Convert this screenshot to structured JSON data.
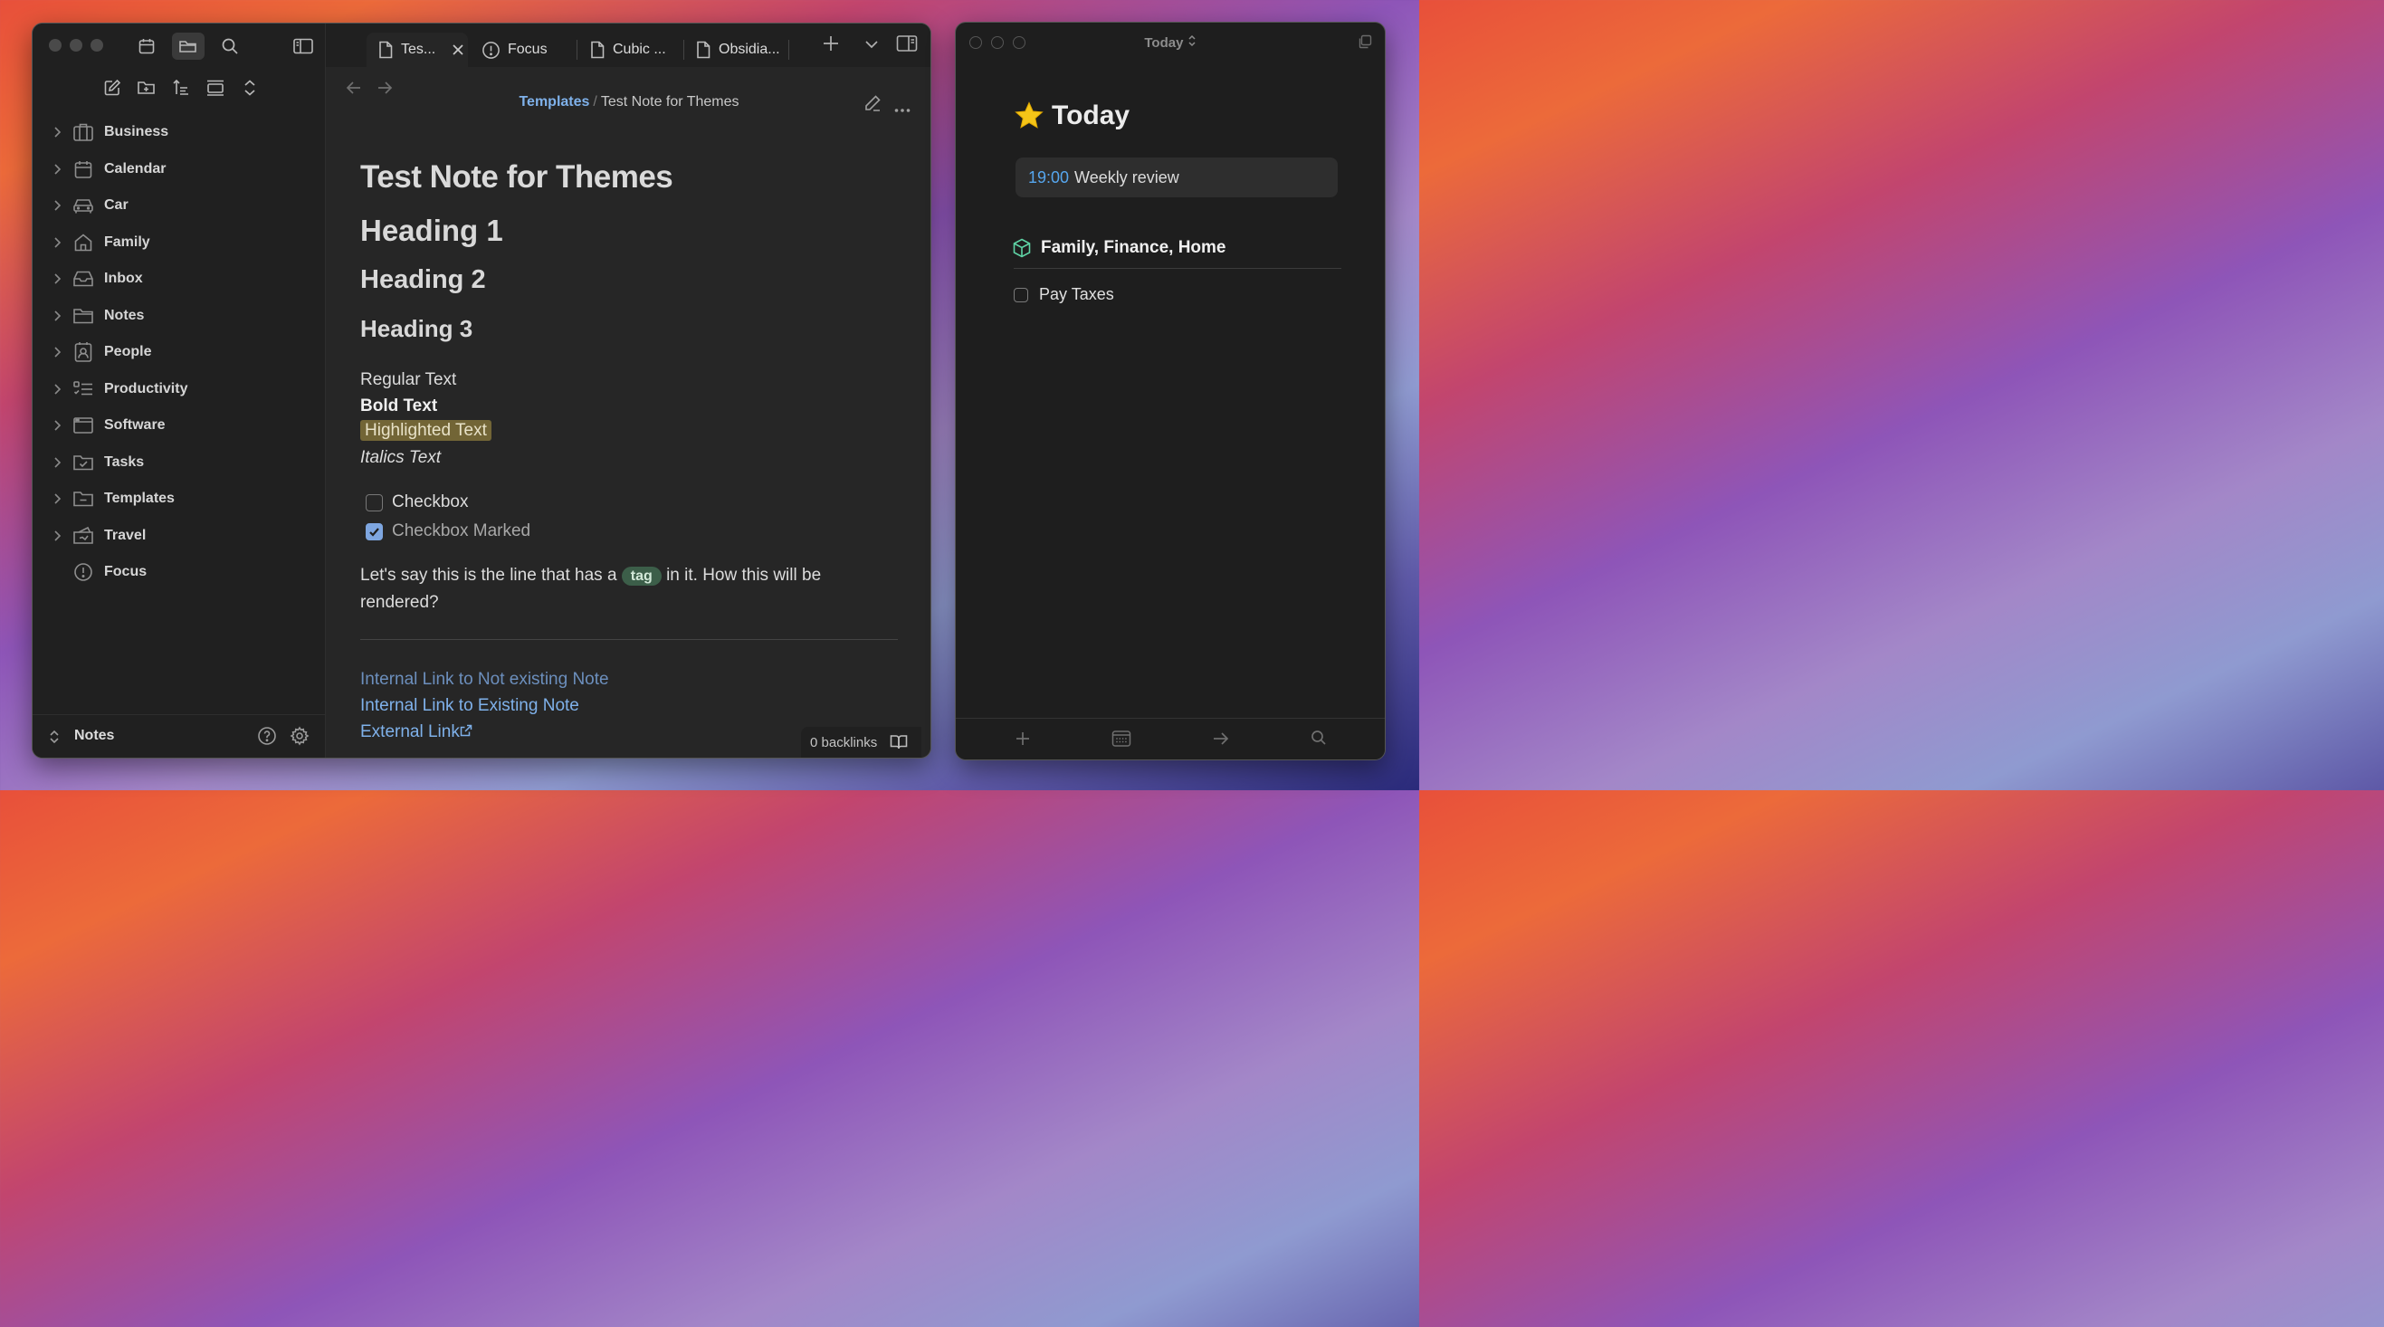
{
  "main_window": {
    "sidebar": {
      "top_icons": [
        "calendar-icon",
        "folder-icon",
        "search-icon"
      ],
      "actions": [
        "new-note-icon",
        "new-folder-icon",
        "sort-icon",
        "collapse-all-icon",
        "expand-icon"
      ],
      "tree": [
        {
          "label": "Business",
          "icon": "briefcase-icon",
          "has_children": true
        },
        {
          "label": "Calendar",
          "icon": "calendar-icon",
          "has_children": true
        },
        {
          "label": "Car",
          "icon": "car-icon",
          "has_children": true
        },
        {
          "label": "Family",
          "icon": "home-icon",
          "has_children": true
        },
        {
          "label": "Inbox",
          "icon": "inbox-icon",
          "has_children": true
        },
        {
          "label": "Notes",
          "icon": "folder-icon",
          "has_children": true
        },
        {
          "label": "People",
          "icon": "contact-icon",
          "has_children": true
        },
        {
          "label": "Productivity",
          "icon": "list-checks-icon",
          "has_children": true
        },
        {
          "label": "Software",
          "icon": "window-icon",
          "has_children": true
        },
        {
          "label": "Tasks",
          "icon": "folder-check-icon",
          "has_children": true
        },
        {
          "label": "Templates",
          "icon": "folder-minus-icon",
          "has_children": true
        },
        {
          "label": "Travel",
          "icon": "plane-ticket-icon",
          "has_children": true
        },
        {
          "label": "Focus",
          "icon": "alert-circle-icon",
          "has_children": false
        }
      ],
      "vault_name": "Notes"
    },
    "tabs": [
      {
        "label": "Tes...",
        "icon": "file-icon",
        "active": true
      },
      {
        "label": "Focus",
        "icon": "alert-circle-icon",
        "active": false
      },
      {
        "label": "Cubic ...",
        "icon": "file-icon",
        "active": false
      },
      {
        "label": "Obsidia...",
        "icon": "file-icon",
        "active": false
      }
    ],
    "breadcrumb": {
      "parent": "Templates",
      "separator": "/",
      "current": "Test Note for Themes"
    },
    "note": {
      "title": "Test Note for Themes",
      "h1": "Heading 1",
      "h2": "Heading 2",
      "h3": "Heading 3",
      "regular": "Regular Text",
      "bold": "Bold Text",
      "highlighted": "Highlighted Text",
      "italics": "Italics Text",
      "checkbox": "Checkbox",
      "checkbox_marked": "Checkbox Marked",
      "para_before": "Let's say this is the line that has a",
      "tag": "tag",
      "para_after": "in it. How this will be rendered?",
      "link_unresolved": "Internal Link to Not existing Note",
      "link_existing": "Internal Link to Existing Note",
      "link_external": "External Link"
    },
    "backlinks": "0 backlinks"
  },
  "today_window": {
    "title": "Today",
    "heading": "Today",
    "event": {
      "time": "19:00",
      "title": "Weekly review"
    },
    "area": "Family, Finance, Home",
    "todos": [
      {
        "label": "Pay Taxes",
        "done": false
      }
    ]
  },
  "colors": {
    "accent_link": "#7fb1ea",
    "checkbox_checked": "#7ea6e0",
    "highlight": "#726536",
    "tag_bg": "#3c5e49",
    "event_time": "#56a6ee",
    "star": "#f5c518"
  }
}
